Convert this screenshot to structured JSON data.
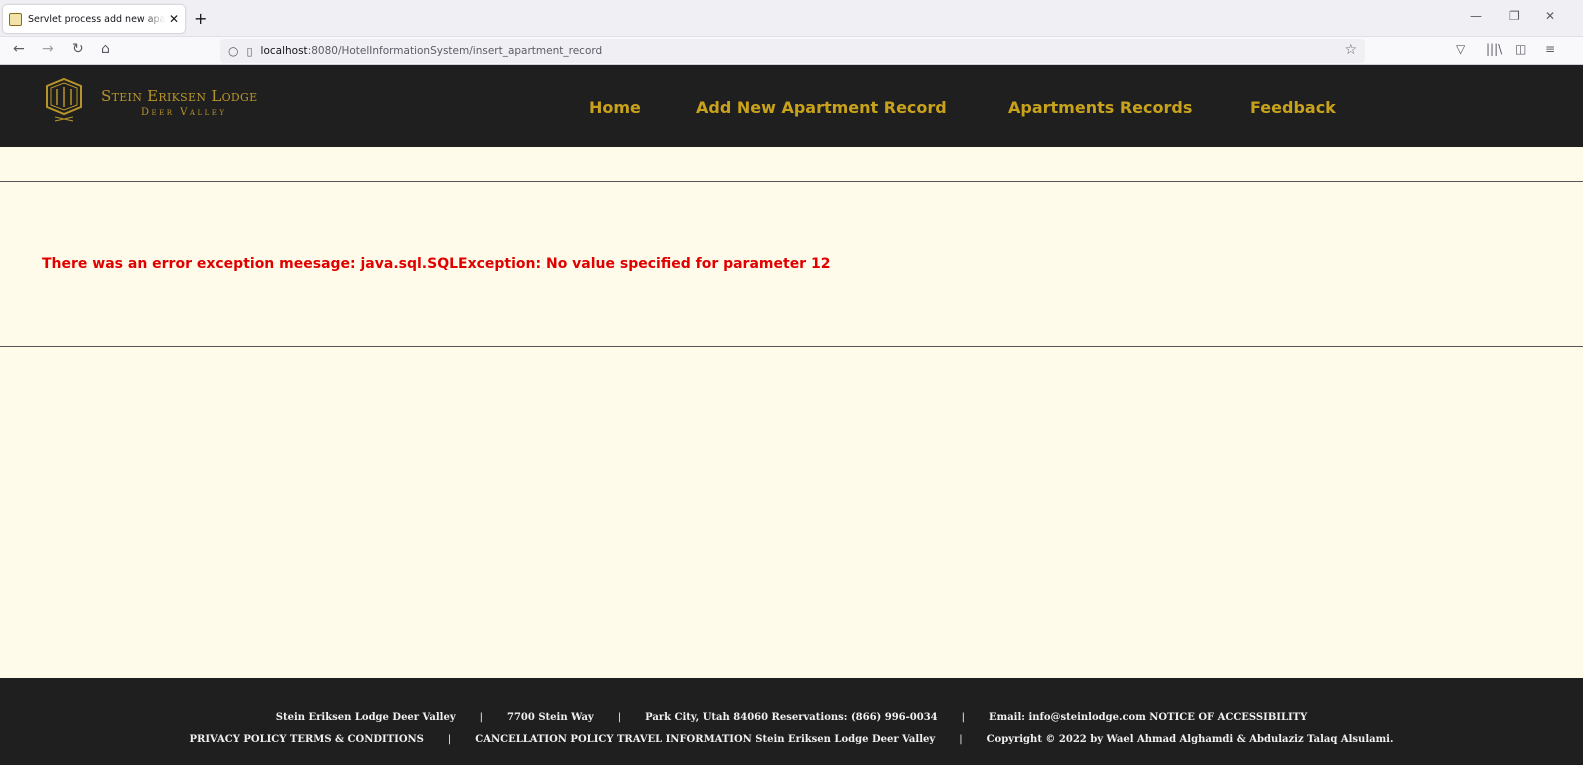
{
  "browser": {
    "tab_title": "Servlet process add new apartm",
    "tab_close": "✕",
    "new_tab": "+",
    "url_host": "localhost",
    "url_rest": ":8080/HotelInformationSystem/insert_apartment_record",
    "icons": [
      "back-icon",
      "forward-icon",
      "reload-icon",
      "home-icon",
      "shield-icon",
      "page-icon",
      "star-icon",
      "pocket-icon",
      "library-icon",
      "sidebar-icon",
      "menu-icon",
      "minimize-icon",
      "restore-icon",
      "close-icon"
    ]
  },
  "header": {
    "logo_title": "Stein Eriksen Lodge",
    "logo_subtitle": "Deer Valley",
    "logo_color": "#b8952b",
    "menu": [
      {
        "label": "Home"
      },
      {
        "label": "Add New Apartment Record"
      },
      {
        "label": "Apartments Records"
      },
      {
        "label": "Feedback"
      }
    ],
    "menu_color": "#c9a21c"
  },
  "content": {
    "error_message": "There was an error exception meesage: java.sql.SQLException: No value specified for parameter 12",
    "error_color": "#e00000",
    "background": "#fffbea"
  },
  "footer": {
    "line1": [
      "Stein Eriksen Lodge Deer Valley",
      "7700 Stein Way",
      "Park City, Utah 84060 Reservations: (866) 996-0034",
      "Email: info@steinlodge.com NOTICE OF ACCESSIBILITY"
    ],
    "line2": [
      "PRIVACY POLICY TERMS & CONDITIONS",
      "CANCELLATION POLICY TRAVEL INFORMATION Stein Eriksen Lodge Deer Valley",
      "Copyright © 2022 by Wael Ahmad Alghamdi & Abdulaziz Talaq Alsulami."
    ],
    "separator": "|"
  }
}
